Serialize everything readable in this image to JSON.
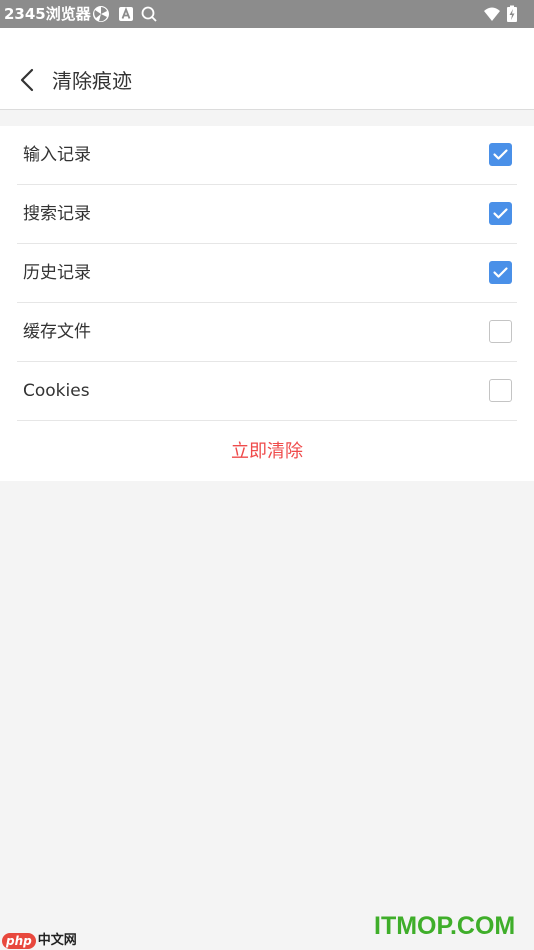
{
  "status_bar": {
    "text": "2345浏览器",
    "icons": [
      "pinwheel-icon",
      "a-square-icon",
      "search-icon",
      "wifi-icon",
      "battery-icon"
    ]
  },
  "header": {
    "back_icon": "chevron-left-icon",
    "title": "清除痕迹"
  },
  "options": [
    {
      "label": "输入记录",
      "checked": true
    },
    {
      "label": "搜索记录",
      "checked": true
    },
    {
      "label": "历史记录",
      "checked": true
    },
    {
      "label": "缓存文件",
      "checked": false
    },
    {
      "label": "Cookies",
      "checked": false
    }
  ],
  "clear_button": {
    "label": "立即清除"
  },
  "watermarks": {
    "left_badge": "php",
    "left_text": "中文网",
    "right_text": "ITMOP.COM"
  },
  "colors": {
    "accent_blue": "#4a90e8",
    "clear_red": "#ef4b4b",
    "status_bar": "#8c8c8c",
    "watermark_green": "#3fae2a"
  }
}
